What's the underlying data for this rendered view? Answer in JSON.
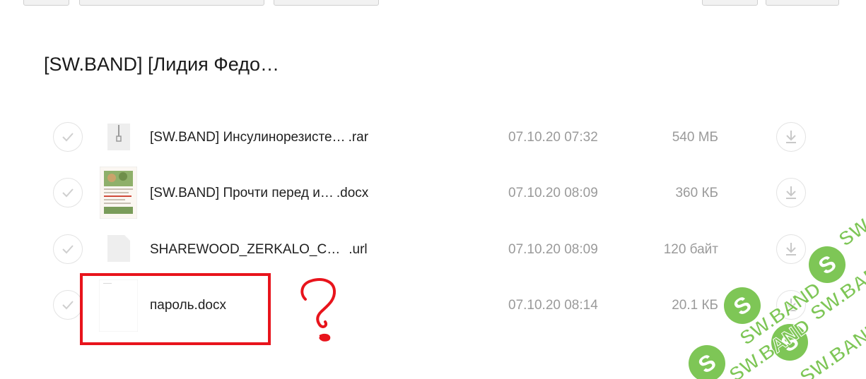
{
  "folder": {
    "title": "[SW.BAND] [Лидия Федо…"
  },
  "files": [
    {
      "name": "[SW.BAND] Инсулинорезисте…",
      "ext": ".rar",
      "date": "07.10.20 07:32",
      "size": "540 МБ"
    },
    {
      "name": "[SW.BAND] Прочти перед и…",
      "ext": ".docx",
      "date": "07.10.20 08:09",
      "size": "360 КБ"
    },
    {
      "name": "SHAREWOOD_ZERKALO_C…",
      "ext": ".url",
      "date": "07.10.20 08:09",
      "size": "120 байт"
    },
    {
      "name": "пароль.docx",
      "ext": "",
      "date": "07.10.20 08:14",
      "size": "20.1 КБ"
    }
  ],
  "annotation": {
    "color": "#e8141c",
    "mark": "question-mark"
  },
  "watermark": {
    "text": "SW.BAND",
    "color": "#6dbf3f"
  },
  "icons": {
    "check": "check-icon",
    "download": "download-icon",
    "archive": "archive-file-icon",
    "doc_preview": "document-preview-icon",
    "blank": "blank-file-icon"
  }
}
